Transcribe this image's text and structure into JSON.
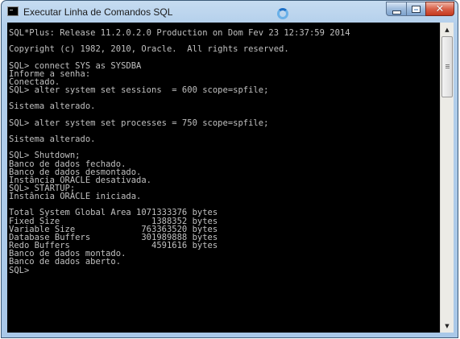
{
  "window": {
    "title": "Executar Linha de Comandos SQL",
    "icons": {
      "app": "console-app-icon",
      "busy": "loading-cursor-icon"
    },
    "controls": {
      "minimize": "minimize-icon",
      "maximize": "maximize-icon",
      "close_symbol": "✕"
    }
  },
  "console": {
    "text_color": "#c0c0c0",
    "background": "#000000",
    "lines": [
      "SQL*Plus: Release 11.2.0.2.0 Production on Dom Fev 23 12:37:59 2014",
      "",
      "Copyright (c) 1982, 2010, Oracle.  All rights reserved.",
      "",
      "SQL> connect SYS as SYSDBA",
      "Informe a senha:",
      "Conectado.",
      "SQL> alter system set sessions  = 600 scope=spfile;",
      "",
      "Sistema alterado.",
      "",
      "SQL> alter system set processes = 750 scope=spfile;",
      "",
      "Sistema alterado.",
      "",
      "SQL> Shutdown;",
      "Banco de dados fechado.",
      "Banco de dados desmontado.",
      "Instância ORACLE desativada.",
      "SQL> STARTUP;",
      "Instância ORACLE iniciada.",
      "",
      "Total System Global Area 1071333376 bytes",
      "Fixed Size                  1388352 bytes",
      "Variable Size             763363520 bytes",
      "Database Buffers          301989888 bytes",
      "Redo Buffers                4591616 bytes",
      "Banco de dados montado.",
      "Banco de dados aberto.",
      "SQL>"
    ]
  },
  "scrollbar": {
    "up_symbol": "▲",
    "down_symbol": "▼"
  }
}
